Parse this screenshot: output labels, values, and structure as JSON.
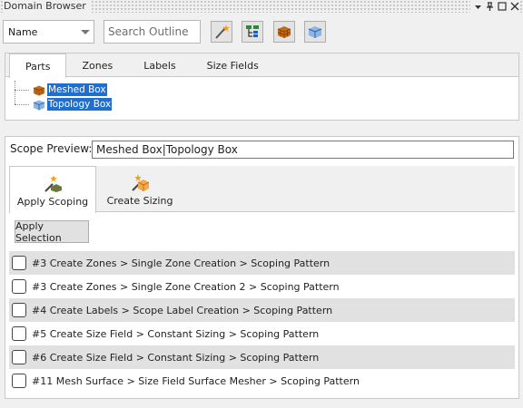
{
  "window": {
    "title": "Domain Browser"
  },
  "toolbar": {
    "select_value": "Name",
    "search_placeholder": "Search Outline",
    "buttons": [
      "wand-icon",
      "filter-tree-icon",
      "meshed-box-icon",
      "topology-box-icon"
    ]
  },
  "outline": {
    "tabs": [
      "Parts",
      "Zones",
      "Labels",
      "Size Fields"
    ],
    "active_tab": "Parts",
    "items": [
      {
        "label": "Meshed Box",
        "icon": "meshed-box-icon"
      },
      {
        "label": "Topology Box",
        "icon": "topology-box-icon"
      }
    ]
  },
  "scope": {
    "label": "Scope Preview:",
    "value": "Meshed Box|Topology Box",
    "tabs": [
      {
        "label": "Apply Scoping",
        "icon": "apply-scoping-icon"
      },
      {
        "label": "Create Sizing",
        "icon": "create-sizing-icon"
      }
    ],
    "active_tab": "Apply Scoping",
    "apply_button": "Apply Selection",
    "rows": [
      {
        "label": "#3 Create Zones > Single Zone Creation > Scoping Pattern",
        "checked": false
      },
      {
        "label": "#3 Create Zones > Single Zone Creation 2 > Scoping Pattern",
        "checked": false
      },
      {
        "label": "#4 Create Labels > Scope Label Creation > Scoping Pattern",
        "checked": false
      },
      {
        "label": "#5 Create Size Field > Constant Sizing > Scoping Pattern",
        "checked": false
      },
      {
        "label": "#6 Create Size Field > Constant Sizing > Scoping Pattern",
        "checked": false
      },
      {
        "label": "#11 Mesh Surface > Size Field Surface Mesher > Scoping Pattern",
        "checked": false
      }
    ]
  },
  "colors": {
    "selection": "#1f6fd1",
    "alt_row": "#e1e1e1",
    "background": "#f0f0f0"
  }
}
